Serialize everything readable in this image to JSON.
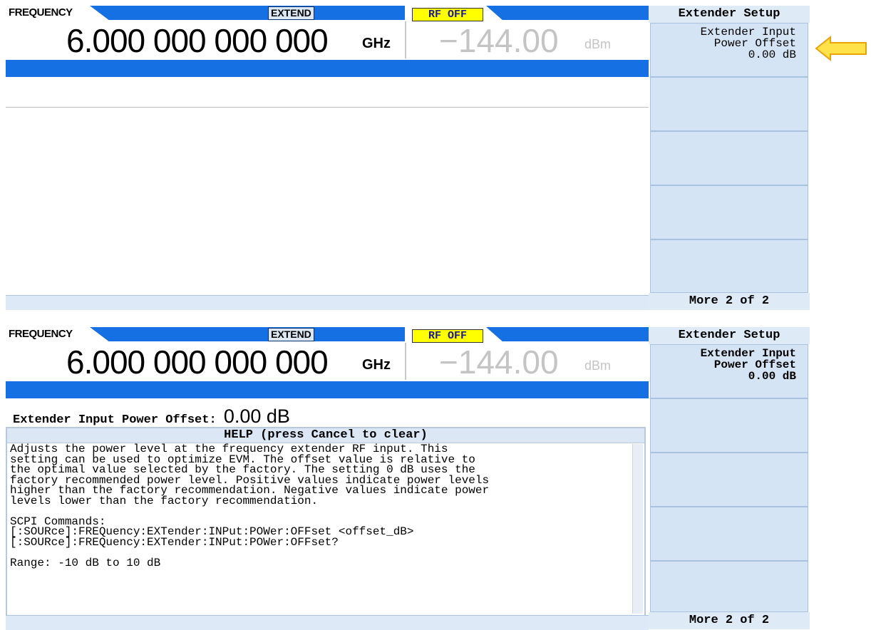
{
  "panels": [
    {
      "header": {
        "freq_label": "FREQUENCY",
        "extend_badge": "EXTEND",
        "rf_badge": "RF OFF",
        "freq_value": "6.000 000 000 000",
        "freq_unit": "GHz",
        "amp_value": "−144.00",
        "amp_unit": "dBm"
      },
      "softkeys": {
        "title": "Extender Setup",
        "key1": "Extender Input\nPower Offset\n0.00 dB",
        "more": "More 2 of 2"
      }
    },
    {
      "header": {
        "freq_label": "FREQUENCY",
        "extend_badge": "EXTEND",
        "rf_badge": "RF OFF",
        "freq_value": "6.000 000 000 000",
        "freq_unit": "GHz",
        "amp_value": "−144.00",
        "amp_unit": "dBm"
      },
      "softkeys": {
        "title": "Extender Setup",
        "key1": "Extender Input\nPower Offset\n0.00 dB",
        "more": "More 2 of 2"
      },
      "entry": {
        "label": "Extender Input Power Offset:",
        "value": "0.00 dB"
      },
      "help": {
        "title": "HELP (press Cancel to clear)",
        "text": "Adjusts the power level at the frequency extender RF input. This\nsetting can be used to optimize EVM. The offset value is relative to\nthe optimal value selected by the factory. The setting 0 dB uses the\nfactory recommended power level. Positive values indicate power levels\nhigher than the factory recommendation. Negative values indicate power\nlevels lower than the factory recommendation.\n\nSCPI Commands:\n[:SOURce]:FREQuency:EXTender:INPut:POWer:OFFset <offset_dB>\n[:SOURce]:FREQuency:EXTender:INPut:POWer:OFFset?\n\nRange: -10 dB to 10 dB"
      }
    }
  ],
  "colors": {
    "accent_blue": "#1570e3",
    "softkey_bg": "#d5e4f5",
    "rf_off_badge": "#ffff00",
    "arrow_fill": "#ffe24a",
    "arrow_outline": "#e8a400"
  }
}
